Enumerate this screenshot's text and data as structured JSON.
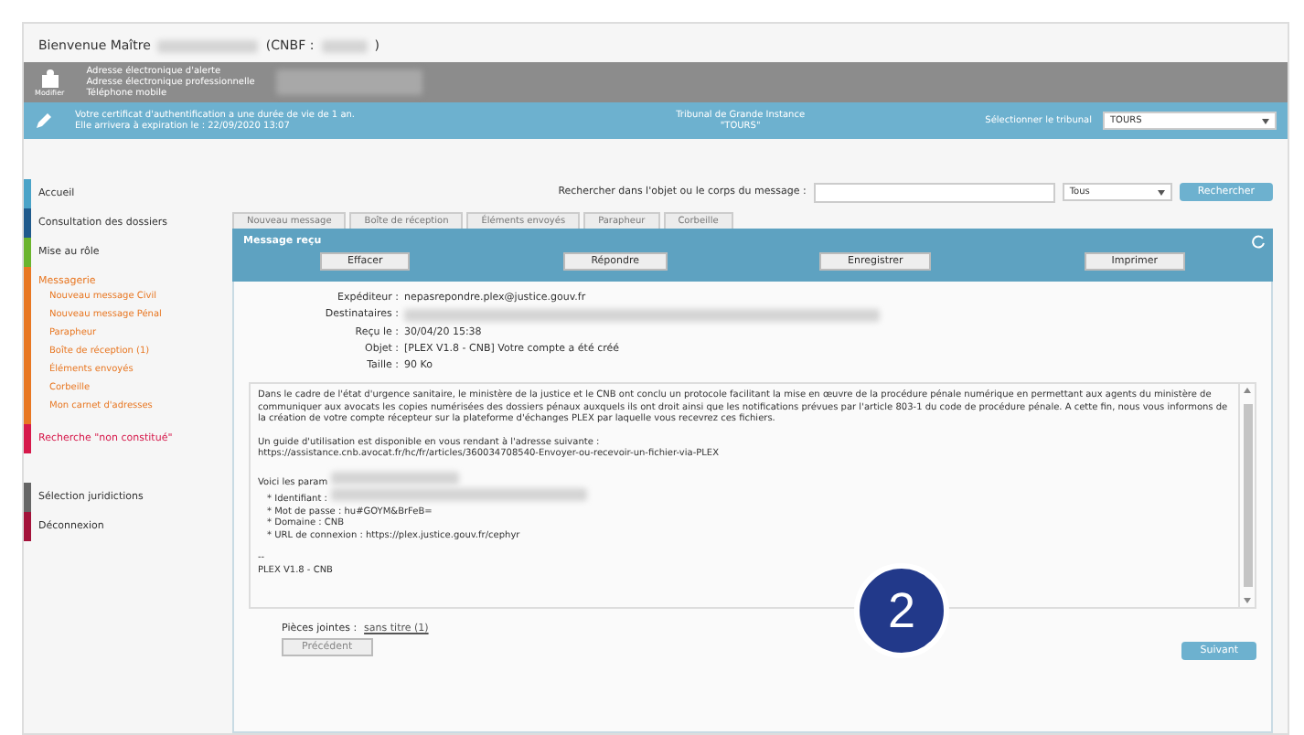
{
  "header": {
    "welcome": "Bienvenue Maître",
    "cnbf_label": "(CNBF :",
    "cnbf_close": ")"
  },
  "profile": {
    "icon_label": "Modifier",
    "lines": [
      "Adresse électronique d'alerte",
      "Adresse électronique professionnelle",
      "Téléphone mobile"
    ]
  },
  "certificate": {
    "lines": [
      "Votre certificat d'authentification a une durée de vie de 1 an.",
      "Elle arrivera à expiration le : 22/09/2020 13:07"
    ]
  },
  "court": {
    "lines": [
      "Tribunal de Grande Instance",
      "\"TOURS\""
    ]
  },
  "court_select": {
    "label": "Sélectionner le tribunal",
    "value": "TOURS"
  },
  "sidebar": {
    "items": [
      {
        "label": "Accueil",
        "color": "#4aa3c8"
      },
      {
        "label": "Consultation des dossiers",
        "color": "#1f5a8c"
      },
      {
        "label": "Mise au rôle",
        "color": "#6ab42d"
      },
      {
        "label": "Messagerie",
        "color": "#e87722",
        "children": [
          "Nouveau message Civil",
          "Nouveau message Pénal",
          "Parapheur",
          "Boîte de réception (1)",
          "Éléments envoyés",
          "Corbeille",
          "Mon carnet d'adresses"
        ]
      },
      {
        "label": "Recherche \"non constitué\"",
        "color": "#d6194b"
      },
      {
        "label": "Sélection juridictions",
        "color": "#666666"
      },
      {
        "label": "Déconnexion",
        "color": "#a3123a"
      }
    ]
  },
  "search": {
    "label": "Rechercher dans l'objet ou le corps du message :",
    "filter": "Tous",
    "button": "Rechercher"
  },
  "tabs": [
    {
      "label": "Nouveau message",
      "selected": false
    },
    {
      "label": "Boîte de réception",
      "selected": false
    },
    {
      "label": "Éléments envoyés",
      "selected": false
    },
    {
      "label": "Parapheur",
      "selected": false
    },
    {
      "label": "Corbeille",
      "selected": false
    }
  ],
  "message": {
    "title": "Message reçu",
    "actions": [
      "Effacer",
      "Répondre",
      "Enregistrer",
      "Imprimer"
    ],
    "fields": [
      {
        "label": "Expéditeur :",
        "value": "nepasrepondre.plex@justice.gouv.fr",
        "redacted": false
      },
      {
        "label": "Destinataires :",
        "redacted": true
      },
      {
        "label": "Reçu le :",
        "value": "30/04/20 15:38",
        "redacted": false
      },
      {
        "label": "Objet :",
        "value": "[PLEX V1.8 - CNB] Votre compte a été créé",
        "redacted": false
      },
      {
        "label": "Taille :",
        "value": "90 Ko",
        "redacted": false
      }
    ],
    "body": [
      {
        "kind": "paragraph",
        "text": "Dans le cadre de l'état d'urgence sanitaire, le ministère de la justice et le CNB ont conclu un protocole facilitant la mise en œuvre de la procédure pénale numérique en permettant aux agents du ministère de communiquer aux avocats les copies numérisées des dossiers pénaux auxquels ils ont droit ainsi que les notifications prévues par l'article 803-1 du code de procédure pénale. A cette fin, nous vous informons de la création de votre compte récepteur sur la plateforme d'échanges PLEX par laquelle vous recevrez ces fichiers."
      },
      {
        "kind": "line",
        "text": "Un guide d'utilisation est disponible en vous rendant à l'adresse suivante :",
        "redacted": false
      },
      {
        "kind": "line",
        "text": "https://assistance.cnb.avocat.fr/hc/fr/articles/360034708540-Envoyer-ou-recevoir-un-fichier-via-PLEX",
        "redacted": false
      },
      {
        "kind": "gap"
      },
      {
        "kind": "line",
        "text": "Voici les param",
        "redacted": true
      },
      {
        "kind": "bullet",
        "text": "* Identifiant :",
        "redacted": true
      },
      {
        "kind": "bullet",
        "text": "* Mot de passe : hu#GOYM&BrFeB=",
        "redacted": false
      },
      {
        "kind": "bullet",
        "text": "* Domaine : CNB",
        "redacted": false
      },
      {
        "kind": "bullet",
        "text": "* URL de connexion : https://plex.justice.gouv.fr/cephyr",
        "redacted": false
      },
      {
        "kind": "gap"
      },
      {
        "kind": "line",
        "text": "--",
        "redacted": false
      },
      {
        "kind": "line",
        "text": "PLEX V1.8 - CNB",
        "redacted": false
      }
    ],
    "attachments_label": "Pièces jointes :",
    "attachment": "sans titre (1)",
    "previous": "Précédent",
    "next": "Suivant"
  },
  "step_badge": "2"
}
